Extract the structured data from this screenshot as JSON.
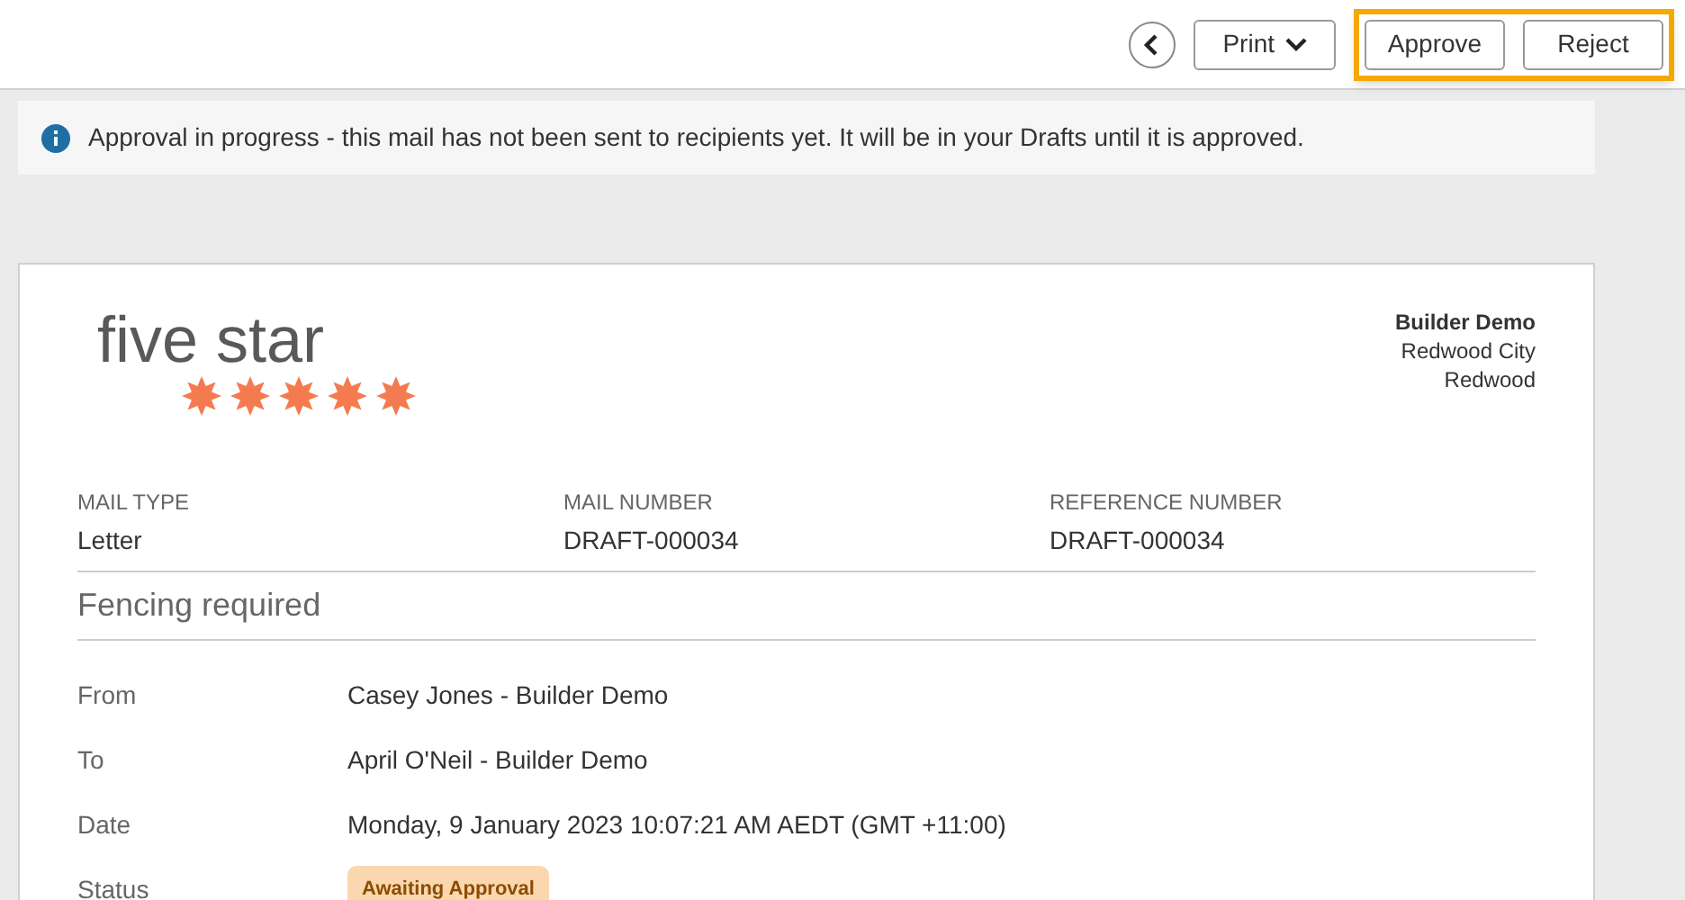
{
  "toolbar": {
    "print_label": "Print",
    "actions": [
      "Approve",
      "Reject"
    ],
    "highlighted": true
  },
  "banner": {
    "message": "Approval in progress - this mail has not been sent to recipients yet. It will be in your Drafts until it is approved."
  },
  "letter": {
    "logo": "five star",
    "company": [
      "Builder Demo",
      "Redwood City",
      "Redwood"
    ],
    "fields": [
      {
        "label": "MAIL TYPE",
        "value": "Letter"
      },
      {
        "label": "MAIL NUMBER",
        "value": "DRAFT-000034"
      },
      {
        "label": "REFERENCE NUMBER",
        "value": "DRAFT-000034"
      }
    ],
    "subject": "Fencing required",
    "details": [
      {
        "label": "From",
        "value": "Casey Jones - Builder Demo",
        "kind": "text"
      },
      {
        "label": "To",
        "value": "April O'Neil - Builder Demo",
        "kind": "text"
      },
      {
        "label": "Date",
        "value": "Monday, 9 January 2023 10:07:21 AM AEDT (GMT +11:00)",
        "kind": "text"
      },
      {
        "label": "Status",
        "value": "Awaiting Approval",
        "kind": "badge"
      }
    ]
  }
}
